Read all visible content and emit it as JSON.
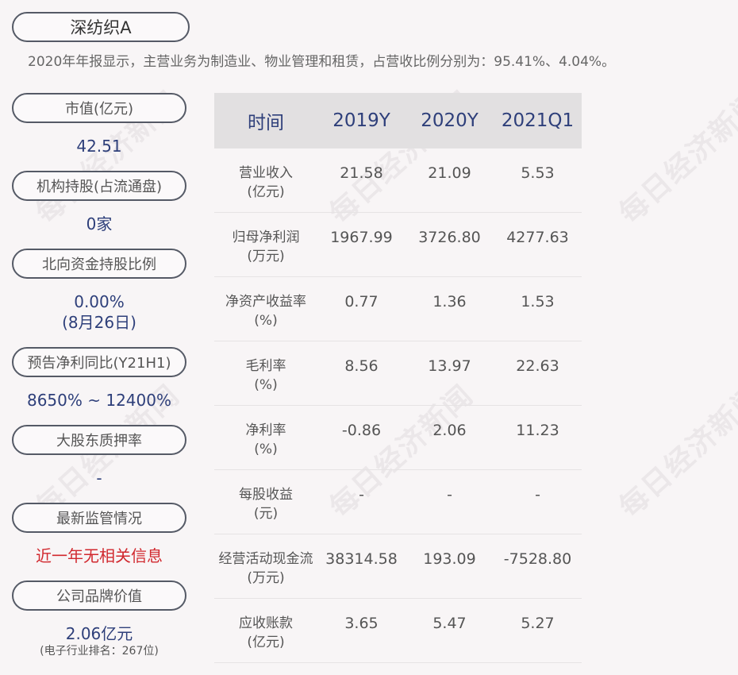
{
  "title": "深纺织A",
  "subtitle": "2020年年报显示，主营业务为制造业、物业管理和租赁，占营收比例分别为：95.41%、4.04%。",
  "sidebar": {
    "items": [
      {
        "label": "市值(亿元)",
        "value": "42.51"
      },
      {
        "label": "机构持股(占流通盘)",
        "value": "0家"
      },
      {
        "label": "北向资金持股比例",
        "value": "0.00%",
        "value2": "(8月26日)"
      },
      {
        "label": "预告净利同比(Y21H1)",
        "value": "8650% ~ 12400%"
      },
      {
        "label": "大股东质押率",
        "value": "-"
      },
      {
        "label": "最新监管情况",
        "value": "近一年无相关信息"
      },
      {
        "label": "公司品牌价值",
        "value": "2.06亿元",
        "note": "(电子行业排名：267位)"
      }
    ]
  },
  "table": {
    "headers": [
      "时间",
      "2019Y",
      "2020Y",
      "2021Q1"
    ],
    "rows": [
      {
        "label": "营业收入",
        "unit": "(亿元)",
        "values": [
          "21.58",
          "21.09",
          "5.53"
        ]
      },
      {
        "label": "归母净利润",
        "unit": "(万元)",
        "values": [
          "1967.99",
          "3726.80",
          "4277.63"
        ]
      },
      {
        "label": "净资产收益率",
        "unit": "(%)",
        "values": [
          "0.77",
          "1.36",
          "1.53"
        ]
      },
      {
        "label": "毛利率",
        "unit": "(%)",
        "values": [
          "8.56",
          "13.97",
          "22.63"
        ]
      },
      {
        "label": "净利率",
        "unit": "(%)",
        "values": [
          "-0.86",
          "2.06",
          "11.23"
        ]
      },
      {
        "label": "每股收益",
        "unit": "(元)",
        "values": [
          "-",
          "-",
          "-"
        ]
      },
      {
        "label": "经营活动现金流",
        "unit": "(万元)",
        "values": [
          "38314.58",
          "193.09",
          "-7528.80"
        ]
      },
      {
        "label": "应收账款",
        "unit": "(亿元)",
        "values": [
          "3.65",
          "5.47",
          "5.27"
        ]
      }
    ]
  },
  "watermark": "每日经济新闻",
  "colors": {
    "accent": "#2e3f7a",
    "alert": "#d1282e",
    "header_bg": "#e2e0e1"
  }
}
